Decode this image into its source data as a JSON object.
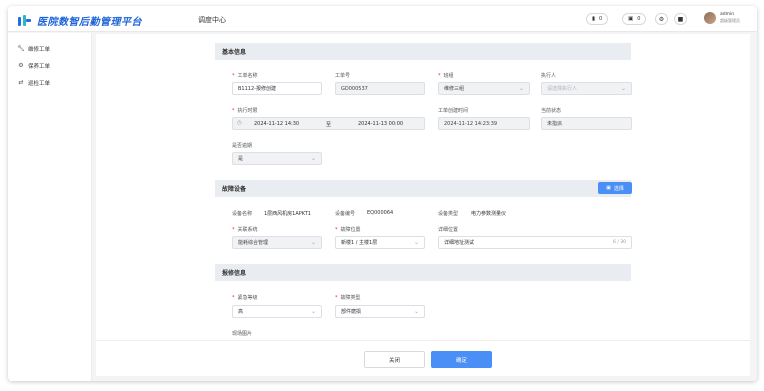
{
  "app": {
    "logo_text": "医院数智后勤管理平台",
    "page_title": "调度中心"
  },
  "header": {
    "pill1_count": "0",
    "pill2_count": "0",
    "user_name": "admin",
    "user_role": "超级管理员"
  },
  "sidebar": {
    "items": [
      {
        "label": "维修工单",
        "icon": "wrench-icon"
      },
      {
        "label": "保养工单",
        "icon": "gear-icon"
      },
      {
        "label": "巡检工单",
        "icon": "route-icon"
      }
    ]
  },
  "basic": {
    "section_title": "基本信息",
    "order_name_label": "工单名称",
    "order_name_value": "B1112-报修创建",
    "order_no_label": "工单号",
    "order_no_value": "GD000537",
    "team_label": "班组",
    "team_value": "维修三组",
    "executor_label": "执行人",
    "executor_placeholder": "请选择执行人",
    "exec_time_label": "执行时限",
    "exec_start": "2024-11-12 14:30",
    "exec_sep": "至",
    "exec_end": "2024-11-13 00:00",
    "created_label": "工单创建时间",
    "created_value": "2024-11-12 14:23:39",
    "status_label": "当前状态",
    "status_value": "未指派",
    "overdue_label": "是否逾期",
    "overdue_value": "是"
  },
  "device": {
    "section_title": "故障设备",
    "select_button": "选择",
    "name_label": "设备名称",
    "name_value": "1层西风机房1APKT1",
    "code_label": "设备编号",
    "code_value": "EQ000064",
    "type_label": "设备类型",
    "type_value": "电力参数测量仪",
    "system_label": "关联系统",
    "system_value": "能耗综合管理",
    "location_label": "故障位置",
    "location_value": "新楼1 / 主楼1层",
    "detail_label": "详细位置",
    "detail_value": "详细地址测试",
    "detail_counter": "6 / 30"
  },
  "repair": {
    "section_title": "报修信息",
    "urgency_label": "紧急等级",
    "urgency_value": "高",
    "fault_type_label": "故障类型",
    "fault_type_value": "部件磨损",
    "photo_label": "现场图片"
  },
  "footer": {
    "close_label": "关闭",
    "confirm_label": "确定"
  },
  "colors": {
    "brand": "#1d63d8",
    "primary_button": "#4a8ff5",
    "required": "#f5222d"
  }
}
